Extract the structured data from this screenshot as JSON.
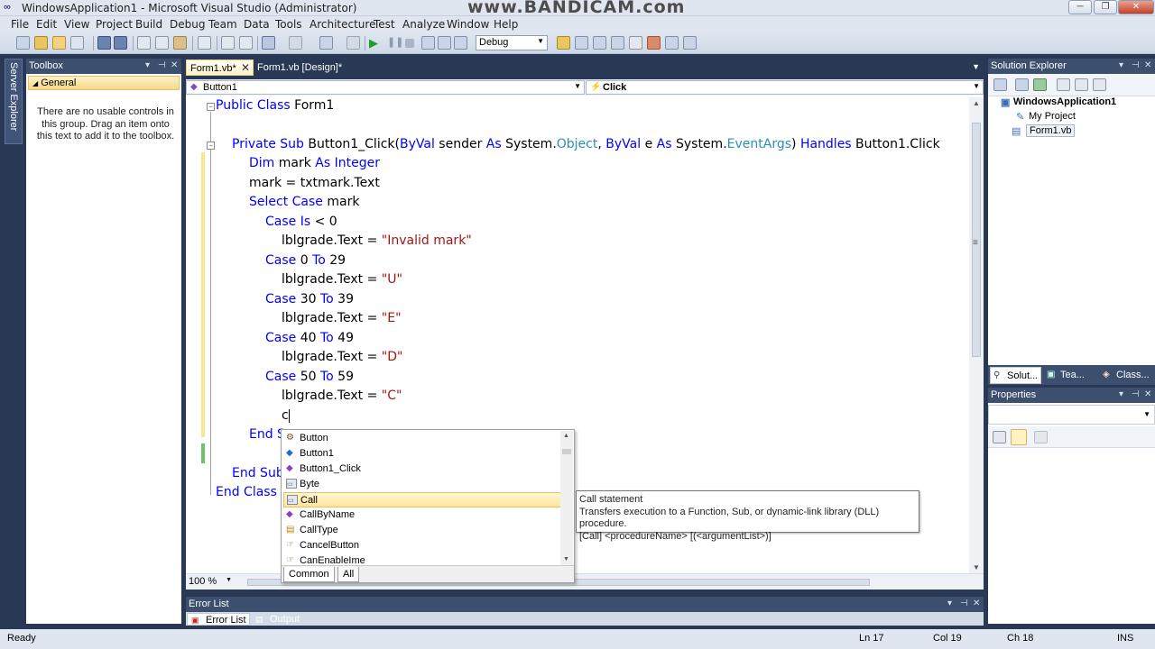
{
  "window": {
    "title": "WindowsApplication1 - Microsoft Visual Studio (Administrator)",
    "watermark": "www.BANDICAM.com",
    "controls": [
      "─",
      "❐",
      "✕"
    ]
  },
  "menu": [
    "File",
    "Edit",
    "View",
    "Project",
    "Build",
    "Debug",
    "Team",
    "Data",
    "Tools",
    "Architecture",
    "Test",
    "Analyze",
    "Window",
    "Help"
  ],
  "toolbar": {
    "configuration": "Debug"
  },
  "server_explorer": {
    "label": "Server Explorer"
  },
  "toolbox": {
    "title": "Toolbox",
    "group": "General",
    "message": "There are no usable controls in this group. Drag an item onto this text to add it to the toolbox."
  },
  "tabs": [
    {
      "label": "Form1.vb*",
      "active": true
    },
    {
      "label": "Form1.vb [Design]*",
      "active": false
    }
  ],
  "editor": {
    "object_selector": "Button1",
    "event_selector": "Click",
    "zoom": "100 %",
    "lines": {
      "l1": {
        "k1": "Public Class",
        "t1": " Form1"
      },
      "l3": {
        "k1": "Private Sub",
        "t1": " Button1_Click(",
        "k2": "ByVal",
        "t2": " sender ",
        "k3": "As",
        "t3": " System.",
        "y1": "Object",
        "t4": ", ",
        "k4": "ByVal",
        "t5": " e ",
        "k5": "As",
        "t6": " System.",
        "y2": "EventArgs",
        "t7": ") ",
        "k6": "Handles",
        "t8": " Button1.Click"
      },
      "l4": {
        "k1": "Dim",
        "t1": " mark ",
        "k2": "As Integer"
      },
      "l5": {
        "t1": "mark = txtmark.Text"
      },
      "l6": {
        "k1": "Select Case",
        "t1": " mark"
      },
      "l7": {
        "k1": "Case Is",
        "t1": " < 0"
      },
      "l8": {
        "t1": "lblgrade.Text = ",
        "s1": "\"Invalid mark\""
      },
      "l9": {
        "k1": "Case",
        "t1": " 0 ",
        "k2": "To",
        "t2": " 29"
      },
      "l10": {
        "t1": "lblgrade.Text = ",
        "s1": "\"U\""
      },
      "l11": {
        "k1": "Case",
        "t1": " 30 ",
        "k2": "To",
        "t2": " 39"
      },
      "l12": {
        "t1": "lblgrade.Text = ",
        "s1": "\"E\""
      },
      "l13": {
        "k1": "Case",
        "t1": " 40 ",
        "k2": "To",
        "t2": " 49"
      },
      "l14": {
        "t1": "lblgrade.Text = ",
        "s1": "\"D\""
      },
      "l15": {
        "k1": "Case",
        "t1": " 50 ",
        "k2": "To",
        "t2": " 59"
      },
      "l16": {
        "t1": "lblgrade.Text = ",
        "s1": "\"C\""
      },
      "l17": {
        "t1": "c"
      },
      "l18": {
        "k1": "End S"
      },
      "l20": {
        "k1": "End Sub"
      },
      "l21": {
        "k1": "End Class"
      }
    }
  },
  "completion": {
    "items": [
      "Button",
      "Button1",
      "Button1_Click",
      "Byte",
      "Call",
      "CallByName",
      "CallType",
      "CancelButton",
      "CanEnableIme"
    ],
    "selected": "Call",
    "tabs": [
      "Common",
      "All"
    ]
  },
  "tooltip": {
    "title": "Call statement",
    "description": "Transfers execution to a Function, Sub, or dynamic-link library (DLL) procedure.",
    "syntax": "[Call] <procedureName> [(<argumentList>)]"
  },
  "error_list": {
    "title": "Error List",
    "tabs": [
      "Error List",
      "Output"
    ]
  },
  "solution_explorer": {
    "title": "Solution Explorer",
    "project": "WindowsApplication1",
    "items": [
      "My Project",
      "Form1.vb"
    ],
    "bottom_tabs": [
      "Solut...",
      "Tea...",
      "Class..."
    ]
  },
  "properties": {
    "title": "Properties"
  },
  "status": {
    "ready": "Ready",
    "line": "Ln 17",
    "col": "Col 19",
    "ch": "Ch 18",
    "mode": "INS"
  },
  "colors": {
    "accent": "#293955",
    "keyword": "#0000ff",
    "type": "#2b91af",
    "string": "#a31515",
    "selection": "#ffe49a"
  }
}
